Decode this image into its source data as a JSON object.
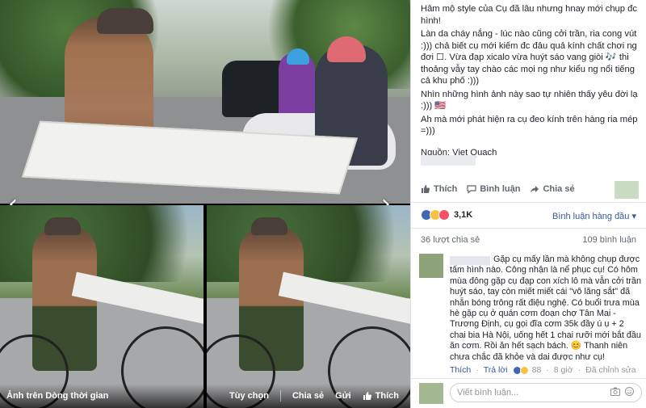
{
  "post": {
    "paragraphs": [
      "Hâm mộ style của Cụ đã lâu nhưng hnay mới chụp đc hình!",
      "Làn da cháy nắng - lúc nào cũng cởi trần, ria cong vút :))) chả biết cụ mới kiếm đc đâu quả kính chất chơi ng đơi ☐. Vừa đạp xicalo vừa huýt sáo vang giòi 🎶 thi thoảng vẫy tay chào các mọi ng như kiểu ng nổi tiếng cả khu phố :)))",
      "Nhìn những hình ảnh này sao tự nhiên thấy yêu đời lạ :))) 🇺🇸",
      "Ah mà mới phát hiện ra cụ đeo kính trên hàng ria mép =)))"
    ],
    "source": "Nguồn: Viet Quach"
  },
  "actions": {
    "like": "Thích",
    "comment": "Bình luận",
    "share": "Chia sẻ"
  },
  "stats": {
    "reactions": "3,1K",
    "sort": "Bình luận hàng đầu ▾",
    "shares": "36 lượt chia sẻ",
    "comments": "109 bình luận"
  },
  "comment": {
    "text": "Gặp cụ mấy lần mà không chụp được tấm hình nào. Công nhận là nể phục cụ! Có hôm mùa đông gặp cụ đạp con xích lô mà vẫn cởi trần huýt sáo, tay còn miết miết cái \"vô lăng sắt\" đã nhẵn bóng trông rất điệu nghệ. Có buổi trưa mùa hè gặp cụ ở quán cơm đoạn chợ Tân Mai - Trương Định, cụ gọi đĩa cơm 35k đầy ú ụ + 2 chai bia Hà Nội, uống hết 1 chai rưỡi mới bắt đầu ăn cơm. Rồi ăn hết sạch bách. 😊 Thanh niên chưa chắc đã khỏe và dai được như cụ!",
    "like": "Thích",
    "reply": "Trả lời",
    "reactions": "88",
    "time": "8 giờ",
    "edited": "Đã chỉnh sửa"
  },
  "composer": {
    "placeholder": "Viết bình luận..."
  },
  "viewer": {
    "album": "Ảnh trên Dòng thời gian",
    "options": "Tùy chọn",
    "share": "Chia sẻ",
    "send": "Gửi",
    "like": "Thích"
  }
}
